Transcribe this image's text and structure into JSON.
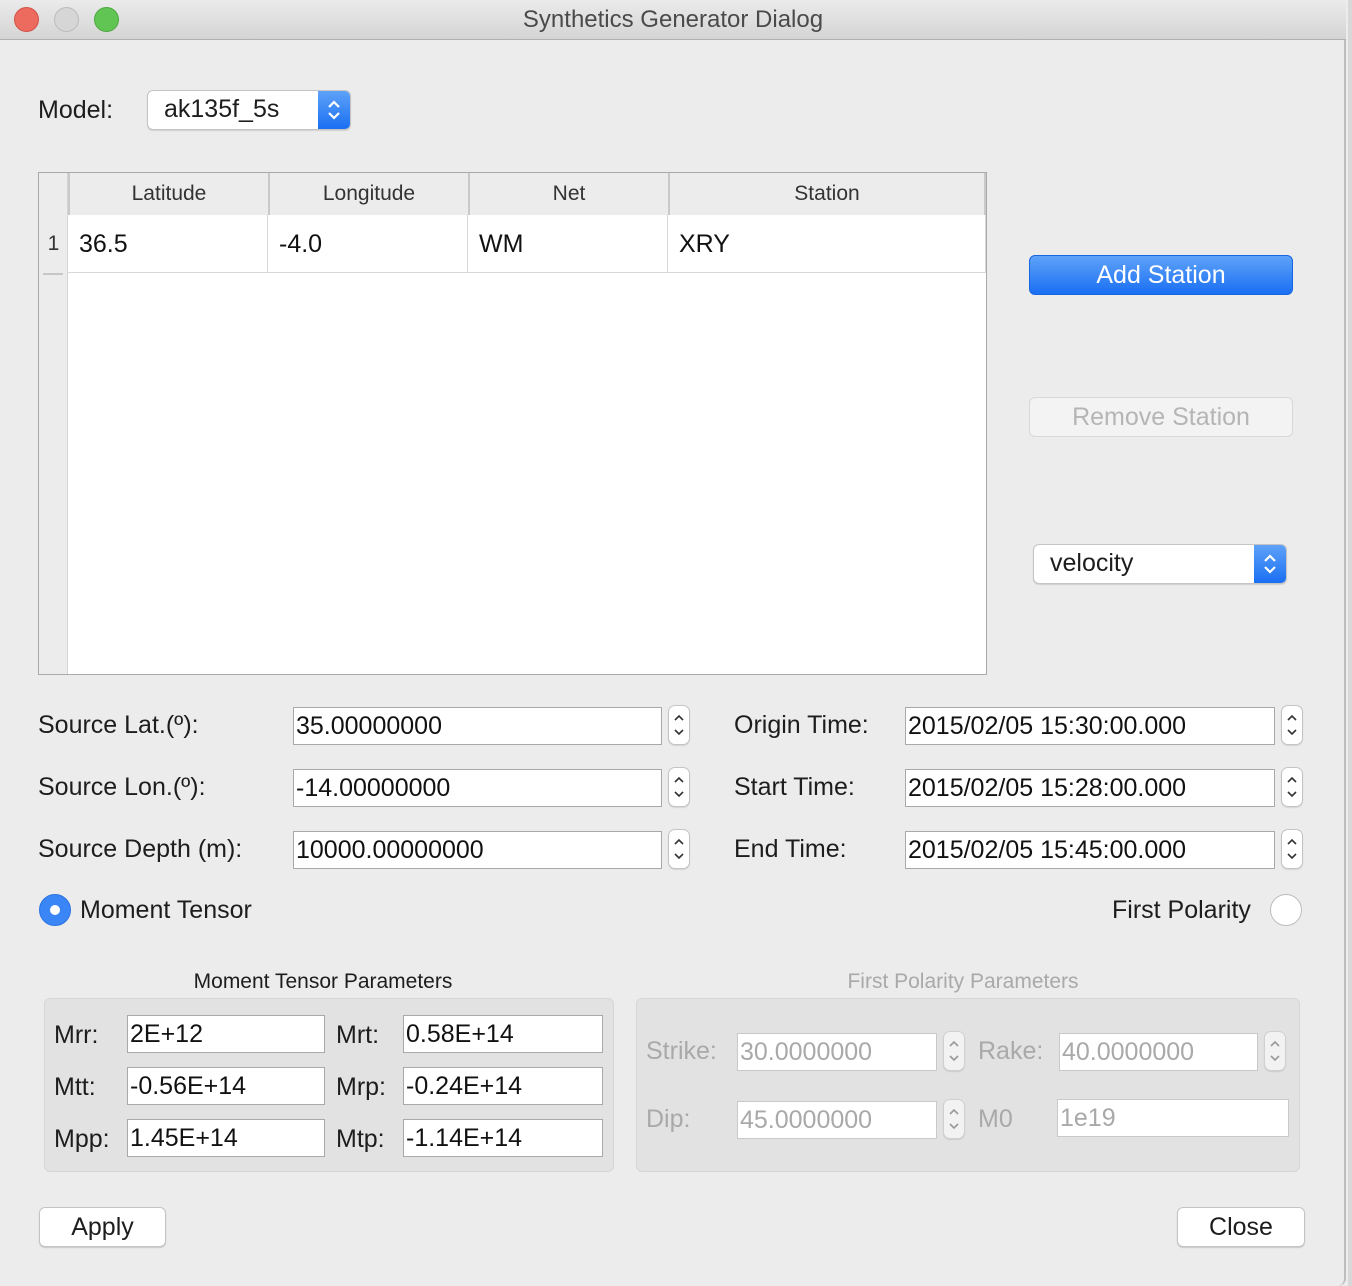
{
  "window": {
    "title": "Synthetics Generator Dialog"
  },
  "model": {
    "label": "Model:",
    "selected": "ak135f_5s",
    "icon": "chevron-up-down-icon"
  },
  "stations_table": {
    "columns": [
      "Latitude",
      "Longitude",
      "Net",
      "Station"
    ],
    "rows": [
      {
        "num": "1",
        "latitude": "36.5",
        "longitude": "-4.0",
        "net": "WM",
        "station": "XRY"
      }
    ]
  },
  "side_panel": {
    "add_station": "Add Station",
    "remove_station": "Remove Station",
    "output_type": "velocity"
  },
  "source": {
    "lat_label": "Source Lat.(º):",
    "lat_value": "35.00000000",
    "lon_label": "Source Lon.(º):",
    "lon_value": "-14.00000000",
    "depth_label": "Source Depth (m):",
    "depth_value": "10000.00000000"
  },
  "times": {
    "origin_label": "Origin Time:",
    "origin_value": "2015/02/05 15:30:00.000",
    "start_label": "Start Time:",
    "start_value": "2015/02/05 15:28:00.000",
    "end_label": "End Time:",
    "end_value": "2015/02/05 15:45:00.000"
  },
  "mode": {
    "moment_tensor_label": "Moment Tensor",
    "moment_tensor_selected": true,
    "first_polarity_label": "First Polarity",
    "first_polarity_selected": false
  },
  "moment_tensor_params": {
    "title": "Moment Tensor Parameters",
    "mrr_label": "Mrr:",
    "mrr": "2E+12",
    "mtt_label": "Mtt:",
    "mtt": "-0.56E+14",
    "mpp_label": "Mpp:",
    "mpp": "1.45E+14",
    "mrt_label": "Mrt:",
    "mrt": "0.58E+14",
    "mrp_label": "Mrp:",
    "mrp": "-0.24E+14",
    "mtp_label": "Mtp:",
    "mtp": "-1.14E+14"
  },
  "first_polarity_params": {
    "title": "First Polarity Parameters",
    "strike_label": "Strike:",
    "strike": "30.0000000",
    "rake_label": "Rake:",
    "rake": "40.0000000",
    "dip_label": "Dip:",
    "dip": "45.0000000",
    "m0_label": "M0",
    "m0": "1e19"
  },
  "footer": {
    "apply": "Apply",
    "close": "Close"
  },
  "colors": {
    "accent": "#1a6ff3",
    "window_bg": "#ececec",
    "disabled_text": "#a9a9a9"
  }
}
